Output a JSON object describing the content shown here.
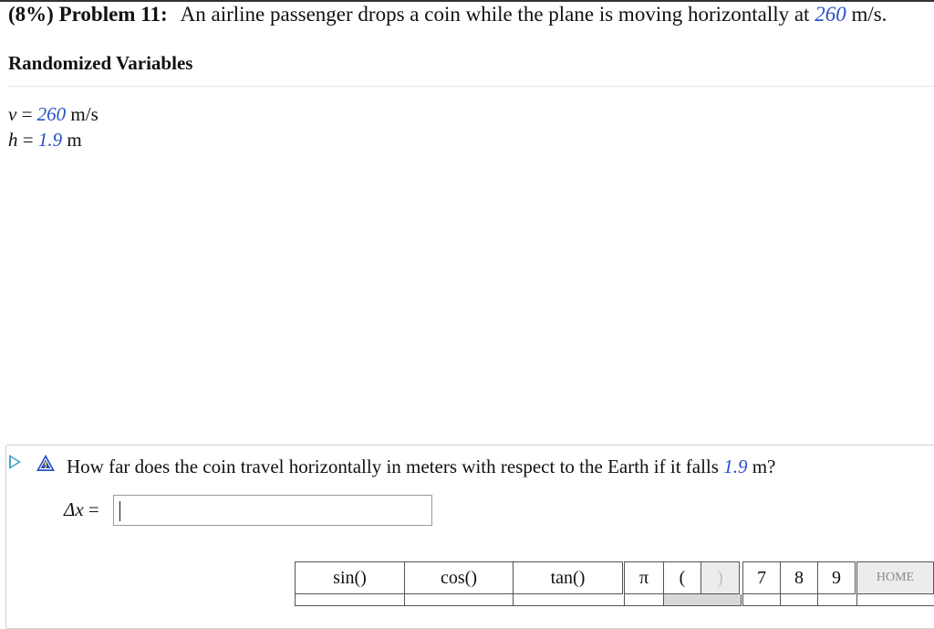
{
  "problem": {
    "percent": "(8%)",
    "number_label": "Problem 11:",
    "statement_prefix": "An airline passenger drops a coin while the plane is moving horizontally at",
    "speed_value": "260",
    "speed_unit": "m/s."
  },
  "randomized": {
    "title": "Randomized Variables",
    "variables": [
      {
        "symbol": "v",
        "equals": " = ",
        "value": "260",
        "unit": " m/s"
      },
      {
        "symbol": "h",
        "equals": " = ",
        "value": "1.9",
        "unit": " m"
      }
    ]
  },
  "question": {
    "text_prefix": "How far does the coin travel horizontally in meters with respect to the Earth if it falls",
    "height_value": "1.9",
    "text_suffix": " m?",
    "answer_label": "Δx",
    "answer_equals": " = ",
    "answer_value": ""
  },
  "icons": {
    "play": "play-arrow-icon",
    "warning": "warning-triangle-icon"
  },
  "keypad": {
    "keys": [
      "sin()",
      "cos()",
      "tan()",
      "π",
      "(",
      ")",
      "7",
      "8",
      "9",
      "HOME"
    ]
  },
  "colors": {
    "variable": "#2a4fc8",
    "play_icon": "#4aa8c8",
    "warning_fill": "#2a4fc8",
    "warning_mark": "#f5c400"
  }
}
